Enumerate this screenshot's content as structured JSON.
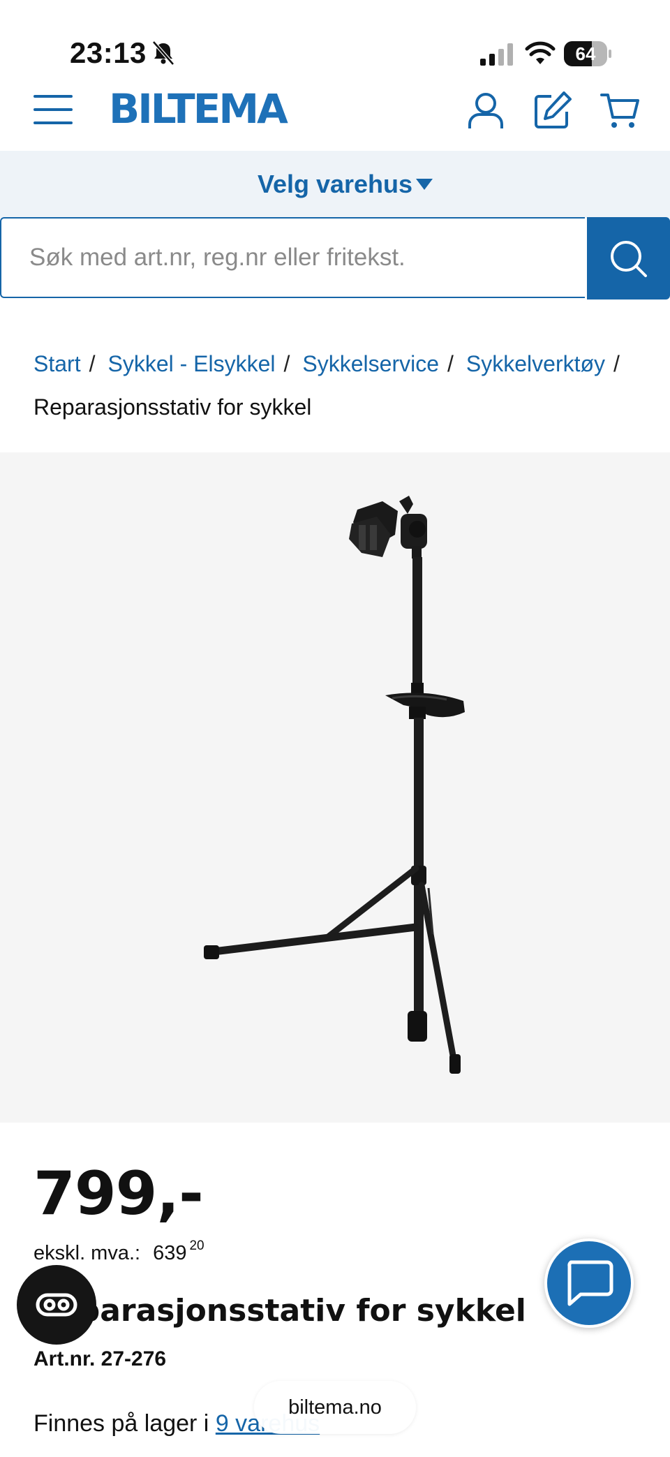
{
  "status_bar": {
    "time": "23:13",
    "battery": "64",
    "battery_level": 0.64
  },
  "header": {
    "logo": "BILTEMA"
  },
  "store": {
    "label": "Velg varehus"
  },
  "search": {
    "placeholder": "Søk med art.nr, reg.nr eller fritekst."
  },
  "breadcrumb": {
    "items": [
      "Start",
      "Sykkel - Elsykkel",
      "Sykkelservice",
      "Sykkelverktøy"
    ],
    "separator": "/",
    "current": "Reparasjonsstativ for sykkel"
  },
  "product": {
    "price": "799,-",
    "ex_vat_label": "ekskl. mva.:",
    "ex_vat_value": "639",
    "ex_vat_decimals": "20",
    "title": "Reparasjonsstativ for sykkel",
    "art_nr": "Art.nr. 27-276",
    "stock_prefix": "Finnes på lager i",
    "stock_link": "9 varehus"
  },
  "browser": {
    "url": "biltema.no"
  },
  "colors": {
    "brand": "#1565a8",
    "logo": "#1e71b8",
    "store_bar_bg": "#eef3f8"
  },
  "icons": {
    "menu": "hamburger-icon",
    "account": "user-icon",
    "edit": "edit-icon",
    "cart": "cart-icon",
    "search": "search-icon",
    "chat": "chat-icon",
    "reader": "reader-icon",
    "bell": "bell-off-icon"
  }
}
